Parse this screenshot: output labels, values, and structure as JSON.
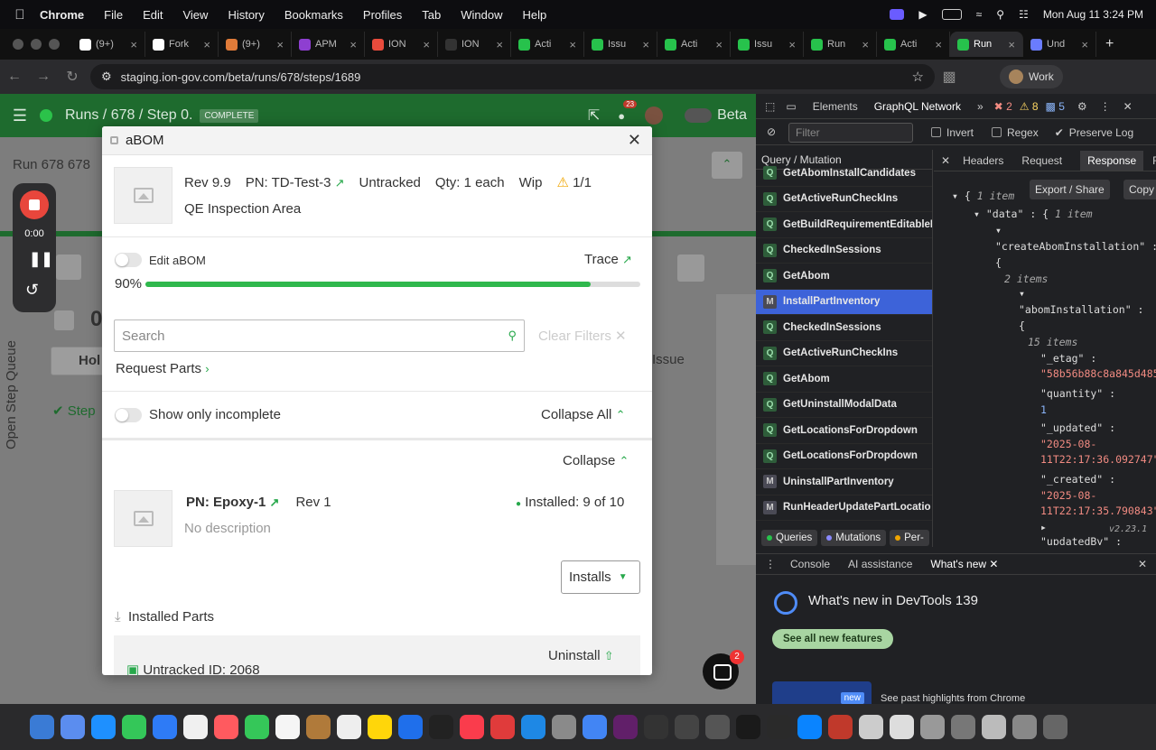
{
  "menubar": {
    "app": "Chrome",
    "items": [
      "File",
      "Edit",
      "View",
      "History",
      "Bookmarks",
      "Profiles",
      "Tab",
      "Window",
      "Help"
    ],
    "clock": "Mon Aug 11  3:24 PM"
  },
  "tabs": [
    {
      "label": "(9+)",
      "color": "#ffffff"
    },
    {
      "label": "Fork",
      "color": "#ffffff"
    },
    {
      "label": "(9+)",
      "color": "#e07b39"
    },
    {
      "label": "APM",
      "color": "#8e3fd1"
    },
    {
      "label": "ION",
      "color": "#e94b3c"
    },
    {
      "label": "ION",
      "color": "#333333"
    },
    {
      "label": "Acti",
      "color": "#27c24c"
    },
    {
      "label": "Issu",
      "color": "#27c24c"
    },
    {
      "label": "Acti",
      "color": "#27c24c"
    },
    {
      "label": "Issu",
      "color": "#27c24c"
    },
    {
      "label": "Run",
      "color": "#27c24c"
    },
    {
      "label": "Acti",
      "color": "#27c24c"
    },
    {
      "label": "Run",
      "color": "#27c24c",
      "active": true
    },
    {
      "label": "Und",
      "color": "#6a7cff"
    }
  ],
  "address": {
    "url": "staging.ion-gov.com/beta/runs/678/steps/1689",
    "profile": "Work"
  },
  "app_header": {
    "breadcrumb": "Runs / 678 / Step 0.",
    "status": "COMPLETE",
    "notifications": "23",
    "beta": "Beta"
  },
  "background": {
    "run_label": "Run  678   678",
    "open_step_queue": "Open Step Queue",
    "hol": "Hol",
    "issue": "Issue",
    "step": "Step",
    "big_zero": "0"
  },
  "recording": {
    "time": "0:00"
  },
  "modal": {
    "title": "aBOM",
    "part": {
      "rev": "Rev 9.9",
      "pn": "PN: TD-Test-3",
      "tracking": "Untracked",
      "qty": "Qty: 1 each",
      "status": "Wip",
      "warning": "1/1",
      "location": "QE Inspection Area"
    },
    "edit_label": "Edit aBOM",
    "trace_label": "Trace",
    "progress_label": "90%",
    "progress": 0.9,
    "search_placeholder": "Search",
    "clear_filters": "Clear Filters",
    "request_parts": "Request Parts",
    "show_incomplete": "Show only incomplete",
    "collapse_all": "Collapse All",
    "collapse": "Collapse",
    "item": {
      "pn": "PN: Epoxy-1",
      "rev": "Rev 1",
      "installed": "Installed: 9 of 10",
      "description": "No description"
    },
    "installs_btn": "Installs",
    "installed_parts": "Installed Parts",
    "uninstall": "Uninstall",
    "untracked_id": "Untracked ID: 2068"
  },
  "devtools": {
    "tabs": [
      "Elements",
      "GraphQL Network"
    ],
    "errors": "2",
    "warnings": "8",
    "info": "5",
    "filter_placeholder": "Filter",
    "invert": "Invert",
    "regex": "Regex",
    "preserve": "Preserve Log",
    "ops_header": "Query / Mutation",
    "operations": [
      {
        "type": "Q",
        "name": "GetAbomInstallCandidates"
      },
      {
        "type": "Q",
        "name": "GetActiveRunCheckIns"
      },
      {
        "type": "Q",
        "name": "GetBuildRequirementEditableI"
      },
      {
        "type": "Q",
        "name": "CheckedInSessions"
      },
      {
        "type": "Q",
        "name": "GetAbom"
      },
      {
        "type": "M",
        "name": "InstallPartInventory",
        "selected": true
      },
      {
        "type": "Q",
        "name": "CheckedInSessions"
      },
      {
        "type": "Q",
        "name": "GetActiveRunCheckIns"
      },
      {
        "type": "Q",
        "name": "GetAbom"
      },
      {
        "type": "Q",
        "name": "GetUninstallModalData"
      },
      {
        "type": "Q",
        "name": "GetLocationsForDropdown"
      },
      {
        "type": "Q",
        "name": "GetLocationsForDropdown"
      },
      {
        "type": "M",
        "name": "UninstallPartInventory"
      },
      {
        "type": "M",
        "name": "RunHeaderUpdatePartLocatio"
      }
    ],
    "resp_tabs": [
      "Headers",
      "Request",
      "Response",
      "R"
    ],
    "export": "Export / Share",
    "copy": "Copy",
    "json": {
      "l1": "{ ",
      "l1m": "1 item",
      "l2": "\"data\" : { ",
      "l2m": "1 item",
      "l3": "\"createAbomInstallation\" :",
      "l4": "{",
      "l5m": "2 items",
      "l6": "\"abomInstallation\" :",
      "l7": "{",
      "l8m": "15 items",
      "etag_k": "\"_etag\" :",
      "etag_v": "\"58b56b88c8a845d485",
      "qty_k": "\"quantity\" :",
      "qty_v": "1",
      "upd_k": "\"_updated\" :",
      "upd_v1": "\"2025-08-",
      "upd_v2": "11T22:17:36.092747\"",
      "cre_k": "\"_created\" :",
      "cre_v1": "\"2025-08-",
      "cre_v2": "11T22:17:35.790843\"",
      "updby_k": "\"updatedBy\" :",
      "version": "v2.23.1"
    },
    "filters": [
      "Queries",
      "Mutations",
      "Per-"
    ],
    "drawer_tabs": [
      "Console",
      "AI assistance",
      "What's new"
    ],
    "whats_new_title": "What's new in DevTools 139",
    "see_all": "See all new features",
    "new_badge": "new",
    "past": "See past highlights from Chrome"
  },
  "chat": {
    "badge": "2"
  },
  "dock": {
    "colors": [
      "#3a7bd5",
      "#5b8def",
      "#1e90ff",
      "#34c759",
      "#2e7bf6",
      "#f0f0f0",
      "#ff5a5f",
      "#35c759",
      "#f5f5f5",
      "#b07a3a",
      "#eeeeee",
      "#ffd60a",
      "#1f6feb",
      "#222222",
      "#fa3c4c",
      "#e03b3b",
      "#1e88e5",
      "#8a8a8a",
      "#4285f4",
      "#611f69",
      "#333333",
      "#444444",
      "#555555",
      "#1a1a1a",
      "#2a2a2a",
      "#0a84ff",
      "#c0392b",
      "#cccccc",
      "#dddddd",
      "#999999",
      "#777777",
      "#bbbbbb",
      "#888888",
      "#666666"
    ]
  }
}
